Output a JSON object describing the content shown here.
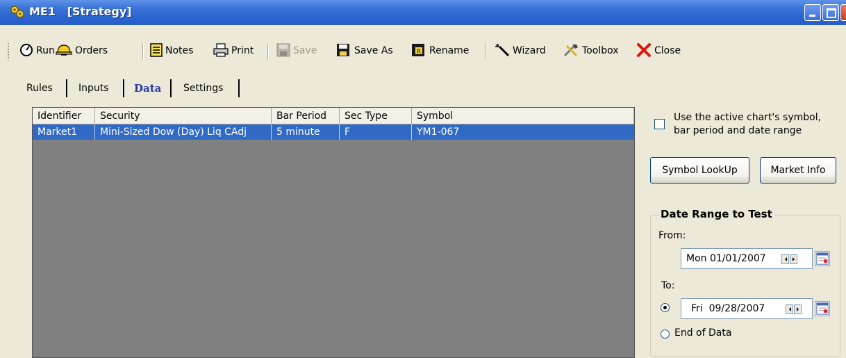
{
  "window": {
    "title": "ME1   [Strategy]"
  },
  "toolbar": {
    "run": "Run",
    "orders": "Orders",
    "notes": "Notes",
    "print": "Print",
    "save": "Save",
    "save_as": "Save As",
    "rename": "Rename",
    "wizard": "Wizard",
    "toolbox": "Toolbox",
    "close": "Close"
  },
  "tabs": {
    "rules": "Rules",
    "inputs": "Inputs",
    "data": "Data",
    "settings": "Settings"
  },
  "grid": {
    "headers": [
      "Identifier",
      "Security",
      "Bar Period",
      "Sec Type",
      "Symbol"
    ],
    "rows": [
      [
        "Market1",
        "Mini-Sized Dow (Day) Liq CAdj",
        "5 minute",
        "F",
        "YM1-067"
      ]
    ]
  },
  "panel": {
    "use_active_line1": "Use the active chart's symbol,",
    "use_active_line2": "bar period and date range",
    "symbol_lookup": "Symbol LookUp",
    "market_info": "Market Info",
    "date_range_title": "Date Range to Test",
    "from_label": "From:",
    "from_date": "Mon 01/01/2007",
    "to_label": "To:",
    "to_date": "Fri  09/28/2007",
    "end_of_data": "End of Data"
  },
  "colors": {
    "titlebar": "#2a63cf",
    "selection": "#316ac5",
    "grid_bg": "#808080",
    "face": "#ece9d8"
  }
}
